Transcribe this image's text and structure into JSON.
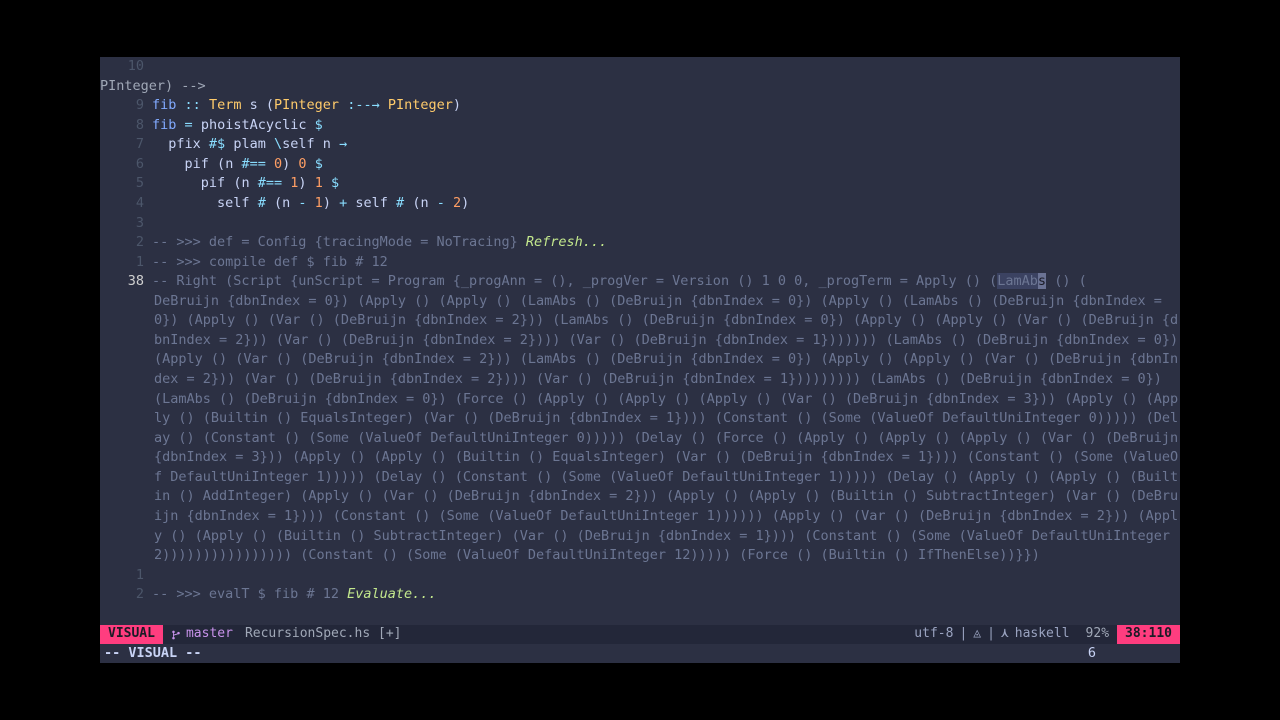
{
  "gutter": {
    "rel": [
      "10",
      "9",
      "8",
      "7",
      "6",
      "5",
      "4",
      "3",
      "2",
      "1"
    ],
    "current": "38",
    "after": [
      "1",
      "2"
    ]
  },
  "code": {
    "l9": {
      "fn": "fib",
      "op1": "::",
      "ty1": "Term",
      "id1": "s",
      "p1": "(",
      "ty2": "PInteger",
      "arr1": ":--→",
      "ty3": "PInteger",
      "p2": ")"
    },
    "l8": {
      "fn": "fib",
      "eq": "=",
      "id1": "phoistAcyclic",
      "dol": "$"
    },
    "l7": {
      "pad": "  ",
      "id1": "pfix",
      "op": "#$",
      "id2": "plam",
      "bs": "\\",
      "id3": "self",
      "id4": "n",
      "arr": "→"
    },
    "l6": {
      "pad": "    ",
      "id1": "pif",
      "p1": "(",
      "id2": "n",
      "op": "#==",
      "n": "0",
      "p2": ")",
      "n2": "0",
      "dol": "$"
    },
    "l5": {
      "pad": "      ",
      "id1": "pif",
      "p1": "(",
      "id2": "n",
      "op": "#==",
      "n": "1",
      "p2": ")",
      "n2": "1",
      "dol": "$"
    },
    "l4": {
      "pad": "        ",
      "id1": "self",
      "h1": "#",
      "p1": "(",
      "id2": "n",
      "m1": "-",
      "n1": "1",
      "p2": ")",
      "plus": "+",
      "id3": "self",
      "h2": "#",
      "p3": "(",
      "id4": "n",
      "m2": "-",
      "n2": "2",
      "p4": ")"
    },
    "l2": {
      "pre": "-- >>> ",
      "txt": "def = Config {tracingMode = NoTracing} ",
      "act": "Refresh..."
    },
    "l1": {
      "pre": "-- >>> ",
      "txt": "compile def $ fib # 12"
    },
    "l38_prefix": "-- Right (Script {unScript = Program {_progAnn = (), _progVer = Version () 1 0 0, _progTerm = Apply () (",
    "l38_sel": "LamAb",
    "l38_cursor": "s",
    "l38_rest": " () (DeBruijn {dbnIndex = 0}) (Apply () (Apply () (LamAbs () (DeBruijn {dbnIndex = 0}) (Apply () (LamAbs () (DeBruijn {dbnIndex = 0}) (Apply () (Var () (DeBruijn {dbnIndex = 2})) (LamAbs () (DeBruijn {dbnIndex = 0}) (Apply () (Apply () (Var () (DeBruijn {dbnIndex = 2})) (Var () (DeBruijn {dbnIndex = 2}))) (Var () (DeBruijn {dbnIndex = 1})))))) (LamAbs () (DeBruijn {dbnIndex = 0}) (Apply () (Var () (DeBruijn {dbnIndex = 2})) (LamAbs () (DeBruijn {dbnIndex = 0}) (Apply () (Apply () (Var () (DeBruijn {dbnIndex = 2})) (Var () (DeBruijn {dbnIndex = 2}))) (Var () (DeBruijn {dbnIndex = 1})))))))) (LamAbs () (DeBruijn {dbnIndex = 0}) (LamAbs () (DeBruijn {dbnIndex = 0}) (Force () (Apply () (Apply () (Apply () (Var () (DeBruijn {dbnIndex = 3})) (Apply () (Apply () (Builtin () EqualsInteger) (Var () (DeBruijn {dbnIndex = 1}))) (Constant () (Some (ValueOf DefaultUniInteger 0))))) (Delay () (Constant () (Some (ValueOf DefaultUniInteger 0))))) (Delay () (Force () (Apply () (Apply () (Apply () (Var () (DeBruijn {dbnIndex = 3})) (Apply () (Apply () (Builtin () EqualsInteger) (Var () (DeBruijn {dbnIndex = 1}))) (Constant () (Some (ValueOf DefaultUniInteger 1))))) (Delay () (Constant () (Some (ValueOf DefaultUniInteger 1))))) (Delay () (Apply () (Apply () (Builtin () AddInteger) (Apply () (Var () (DeBruijn {dbnIndex = 2})) (Apply () (Apply () (Builtin () SubtractInteger) (Var () (DeBruijn {dbnIndex = 1}))) (Constant () (Some (ValueOf DefaultUniInteger 1)))))) (Apply () (Var () (DeBruijn {dbnIndex = 2})) (Apply () (Apply () (Builtin () SubtractInteger) (Var () (DeBruijn {dbnIndex = 1}))) (Constant () (Some (ValueOf DefaultUniInteger 2)))))))))))))))) (Constant () (Some (ValueOf DefaultUniInteger 12))))) (Force () (Builtin () IfThenElse))}})",
    "a2": {
      "pre": "-- >>> ",
      "txt": "evalT $ fib # 12 ",
      "act": "Evaluate..."
    }
  },
  "status": {
    "mode": "VISUAL",
    "branch": "master",
    "file": "RecursionSpec.hs [+]",
    "encoding": "utf-8",
    "sep1": "|",
    "os_icon": "",
    "sep2": "|",
    "lang_icon": "⋏",
    "lang": "haskell",
    "percent": "92%",
    "pos": "38:110"
  },
  "cmdline": {
    "mode": "-- VISUAL --",
    "count": "6"
  }
}
